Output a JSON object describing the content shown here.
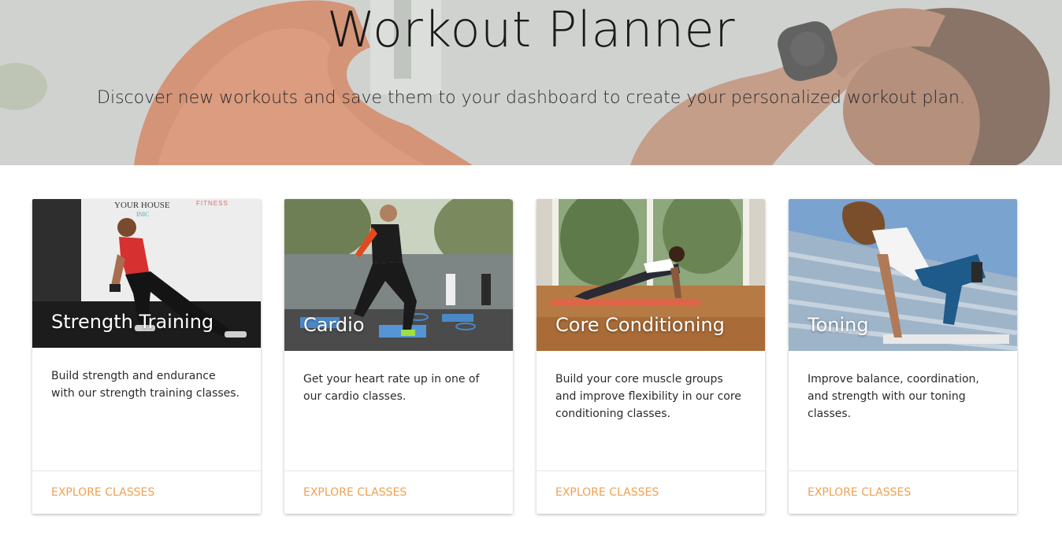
{
  "hero": {
    "title": "Workout Planner",
    "subtitle": "Discover new workouts and save them to your dashboard to create your personalized workout plan."
  },
  "cards": [
    {
      "title": "Strength Training",
      "description": "Build strength and endurance with our strength training classes.",
      "action": "EXPLORE CLASSES",
      "image_text": [
        "YOUR HOUSE",
        "INIC",
        "FITNESS"
      ]
    },
    {
      "title": "Cardio",
      "description": "Get your heart rate up in one of our cardio classes.",
      "action": "EXPLORE CLASSES"
    },
    {
      "title": "Core Conditioning",
      "description": "Build your core muscle groups and improve flexibility in our core conditioning classes.",
      "action": "EXPLORE CLASSES"
    },
    {
      "title": "Toning",
      "description": "Improve balance, coordination, and strength with our toning classes.",
      "action": "EXPLORE CLASSES"
    }
  ],
  "colors": {
    "accent": "#f0a050",
    "text": "#2b2b2b",
    "heading": "#1a1a1a",
    "card_background": "#ffffff"
  }
}
